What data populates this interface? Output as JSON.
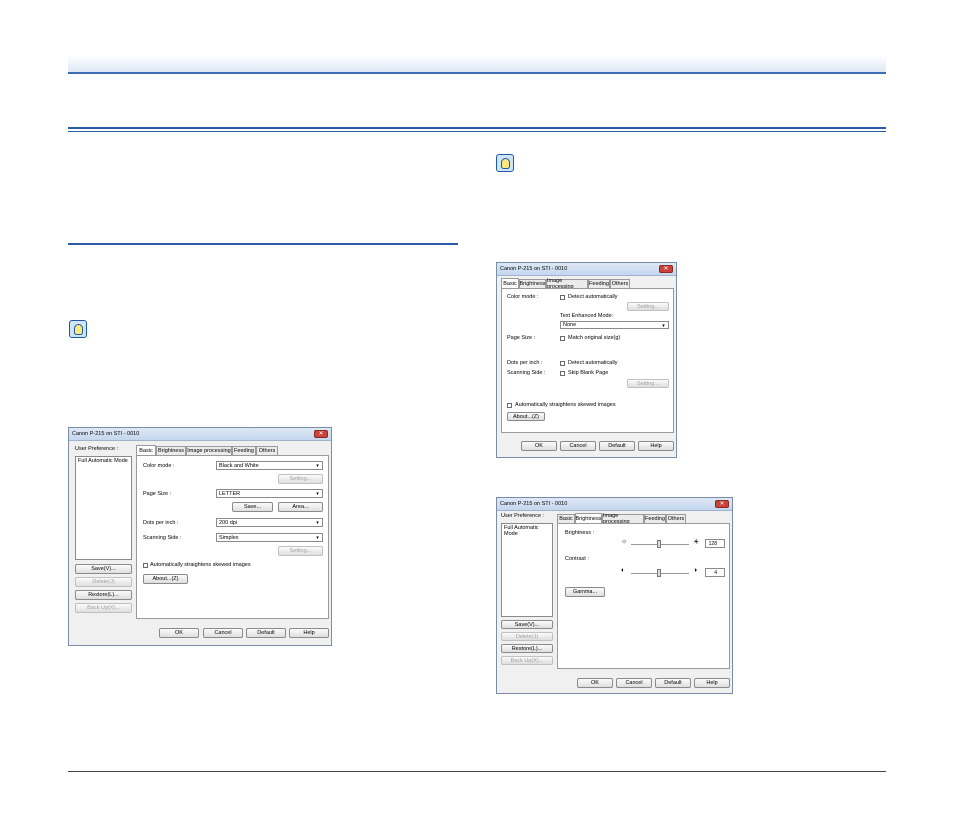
{
  "dialog1": {
    "title": "Canon P-215 on STI - 0010",
    "close": "✕",
    "user_pref_label": "User Preference :",
    "user_pref_item": "Full Automatic Mode",
    "tabs": [
      "Basic",
      "Brightness",
      "Image processing",
      "Feeding",
      "Others"
    ],
    "color_mode_label": "Color mode :",
    "color_mode_value": "Black and White",
    "setting1": "Setting...",
    "page_size_label": "Page Size :",
    "page_size_value": "LETTER",
    "save_dots": "Save...",
    "area_dots": "Area...",
    "dpi_label": "Dots per inch :",
    "dpi_value": "200 dpi",
    "side_label": "Scanning Side :",
    "side_value": "Simplex",
    "setting2": "Setting...",
    "straighten_label": "Automatically straightens skewed images",
    "about": "About...(Z)",
    "left_buttons": [
      "Save(V)...",
      "Delete(J)",
      "Restore(L)...",
      "Back Up(X)..."
    ],
    "bottom_buttons": [
      "OK",
      "Cancel",
      "Default",
      "Help"
    ]
  },
  "dialog2": {
    "title": "Canon P-215 on STI - 0010",
    "close": "✕",
    "tabs": [
      "Basic",
      "Brightness",
      "Image processing",
      "Feeding",
      "Others"
    ],
    "color_mode_label": "Color mode :",
    "detect_auto1": "Detect automatically",
    "setting1": "Setting...",
    "text_enh_label": "Text Enhanced Mode:",
    "text_enh_value": "None",
    "page_size_label": "Page Size :",
    "match_original": "Match original size(g)",
    "dpi_label": "Dots per inch :",
    "detect_auto2": "Detect automatically",
    "side_label": "Scanning Side :",
    "skip_blank": "Skip Blank Page",
    "setting2": "Setting...",
    "straighten_label": "Automatically straightens skewed images",
    "about": "About...(Z)",
    "bottom_buttons": [
      "OK",
      "Cancel",
      "Default",
      "Help"
    ]
  },
  "dialog3": {
    "title": "Canon P-215 on STI - 0010",
    "close": "✕",
    "user_pref_label": "User Preference :",
    "user_pref_item": "Full Automatic Mode",
    "tabs": [
      "Basic",
      "Brightness",
      "Image processing",
      "Feeding",
      "Others"
    ],
    "brightness_label": "Brightness :",
    "brightness_value": "128",
    "contrast_label": "Contrast :",
    "contrast_value": "4",
    "gamma": "Gamma...",
    "left_buttons": [
      "Save(V)...",
      "Delete(J)",
      "Restore(L)...",
      "Back Up(X)..."
    ],
    "bottom_buttons": [
      "OK",
      "Cancel",
      "Default",
      "Help"
    ]
  }
}
